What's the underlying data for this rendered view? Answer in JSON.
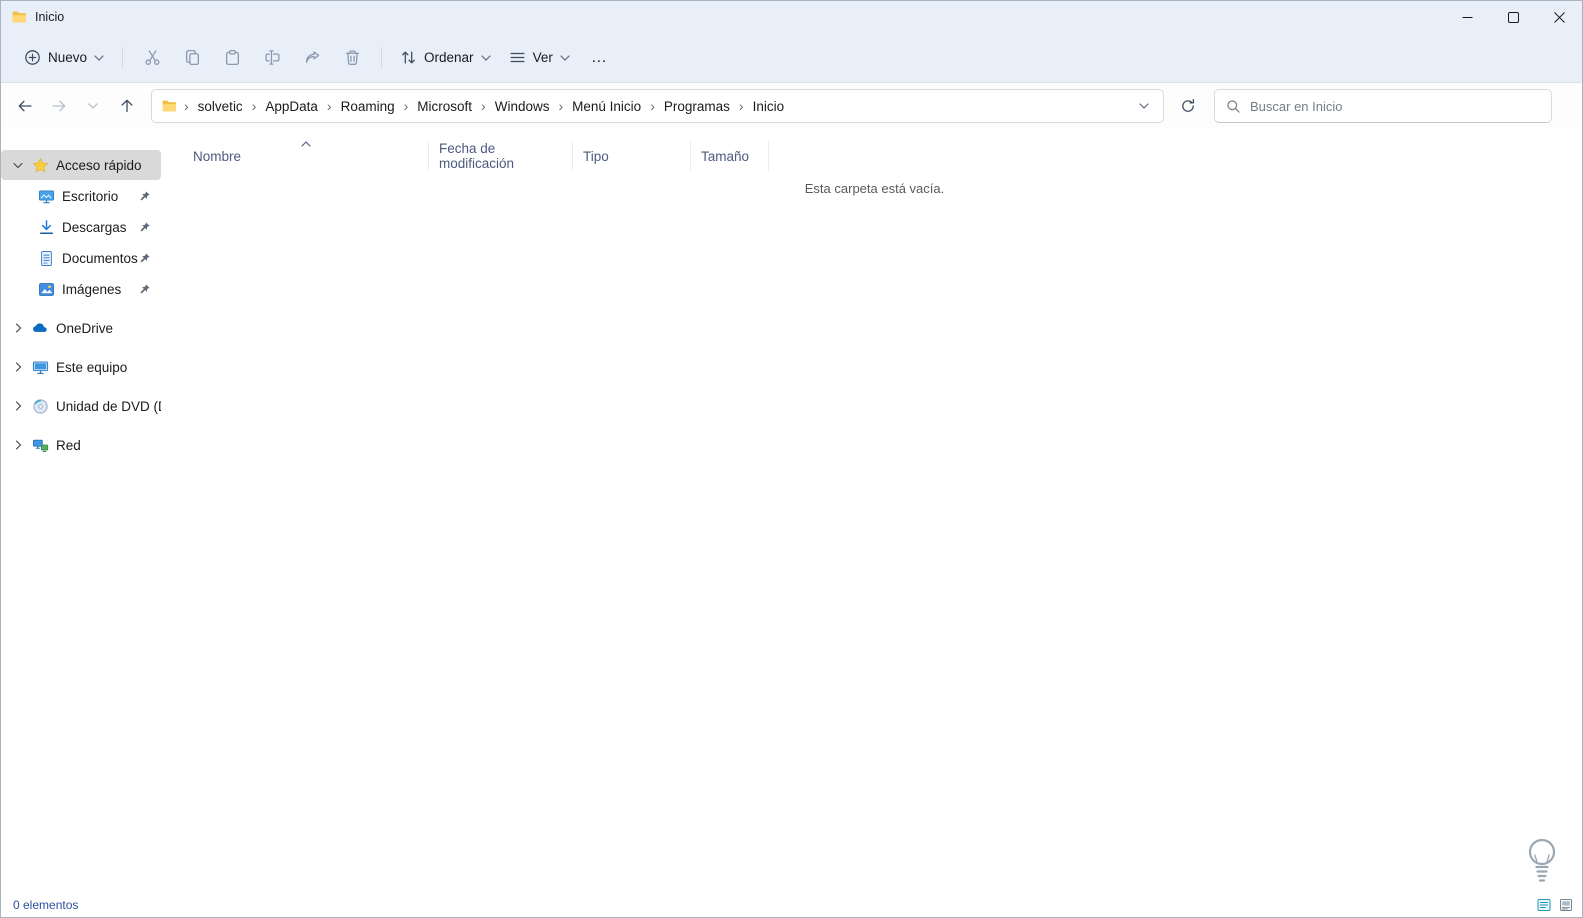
{
  "window": {
    "title": "Inicio"
  },
  "toolbar": {
    "new_label": "Nuevo",
    "sort_label": "Ordenar",
    "view_label": "Ver",
    "more_label": "…"
  },
  "navbar": {
    "breadcrumbs": [
      "solvetic",
      "AppData",
      "Roaming",
      "Microsoft",
      "Windows",
      "Menú Inicio",
      "Programas",
      "Inicio"
    ],
    "separator": "›",
    "search_placeholder": "Buscar en Inicio"
  },
  "sidebar": {
    "quick_access_label": "Acceso rápido",
    "quick_access_items": [
      {
        "label": "Escritorio",
        "pinned": true
      },
      {
        "label": "Descargas",
        "pinned": true
      },
      {
        "label": "Documentos",
        "pinned": true
      },
      {
        "label": "Imágenes",
        "pinned": true
      }
    ],
    "roots": [
      {
        "label": "OneDrive"
      },
      {
        "label": "Este equipo"
      },
      {
        "label": "Unidad de DVD (D:)"
      },
      {
        "label": "Red"
      }
    ]
  },
  "main": {
    "columns": [
      "Nombre",
      "Fecha de modificación",
      "Tipo",
      "Tamaño"
    ],
    "empty_message": "Esta carpeta está vacía."
  },
  "statusbar": {
    "items_count": "0 elementos"
  },
  "colors": {
    "accent": "#0067c0",
    "chrome": "#e8eff9",
    "selection": "#d9d9d9",
    "folder": "#ffd978"
  }
}
